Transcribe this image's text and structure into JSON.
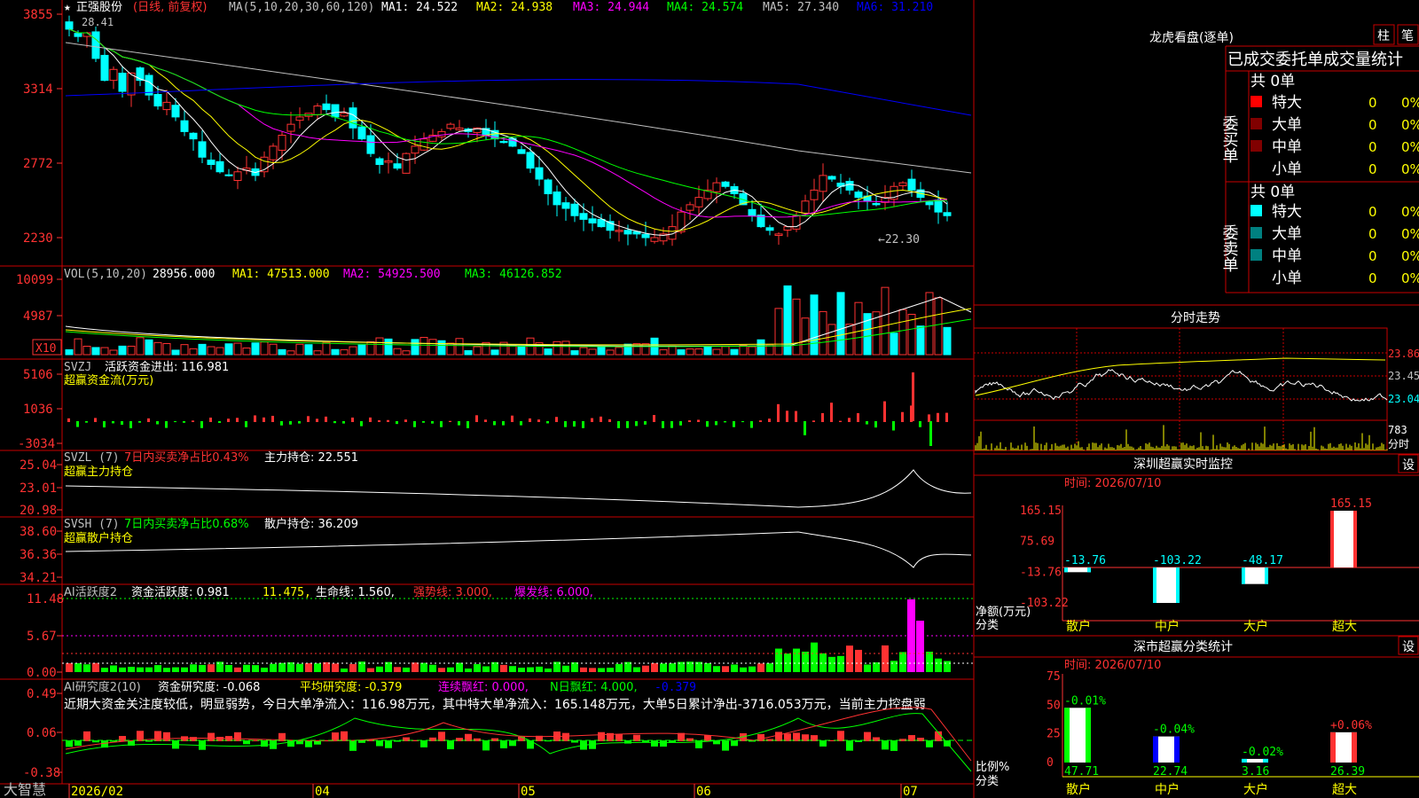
{
  "app": {
    "brand": "大智慧"
  },
  "colors": {
    "bg": "#000000",
    "grid": "#ff0000",
    "up": "#ff3232",
    "down": "#00ffff",
    "white": "#ffffff",
    "yellow": "#ffff00",
    "magenta": "#ff00ff",
    "green": "#00ff00",
    "blue": "#0000ff",
    "axis": "#ff3232"
  },
  "kline": {
    "title_star": "★",
    "stock": "正强股份",
    "period": "(日线, 前复权)",
    "ma_def": "MA(5,10,20,30,60,120)",
    "ma1": "MA1: 24.522",
    "ma2": "MA2: 24.938",
    "ma3": "MA3: 24.944",
    "ma4": "MA4: 24.574",
    "ma5": "MA5: 27.340",
    "ma6": "MA6: 31.210",
    "y_ticks": [
      "3855",
      "3314",
      "2772",
      "2230"
    ],
    "high_note": "28.41",
    "low_note": "←22.30"
  },
  "vol": {
    "def": "VOL(5,10,20)",
    "value": "28956.000",
    "ma1": "MA1: 47513.000",
    "ma2": "MA2: 54925.500",
    "ma3": "MA3: 46126.852",
    "y_ticks": [
      "10099",
      "4987"
    ],
    "unit": "X10"
  },
  "svzj": {
    "def": "SVZJ",
    "label": "活跃资金进出: 116.981",
    "sub": "超赢资金流(万元)",
    "y_ticks": [
      "5106",
      "1036",
      "-3034"
    ]
  },
  "svzl": {
    "def": "SVZL (7)",
    "hint": "7日内买卖净占比0.43%",
    "label": "主力持仓: 22.551",
    "sub": "超赢主力持仓",
    "y_ticks": [
      "25.04",
      "23.01",
      "20.98"
    ]
  },
  "svsh": {
    "def": "SVSH (7)",
    "hint": "7日内买卖净占比0.68%",
    "label": "散户持仓: 36.209",
    "sub": "超赢散户持仓",
    "y_ticks": [
      "38.60",
      "36.36",
      "34.21"
    ]
  },
  "ai2": {
    "def": "AI活跃度2",
    "l1": "资金活跃度: 0.981",
    "l2": "11.475,",
    "l3": "生命线: 1.560,",
    "l4": "强势线: 3.000,",
    "l5": "爆发线: 6.000,",
    "y_ticks": [
      "11.48",
      "5.67",
      "0.00"
    ]
  },
  "air": {
    "def": "AI研究度2(10)",
    "l1": "资金研究度: -0.068",
    "l2": "平均研究度: -0.379",
    "l3": "连续飘红: 0.000,",
    "l4": "N日飘红: 4.000,",
    "l5": "-0.379",
    "y_ticks": [
      "0.49",
      "0.06",
      "-0.38"
    ],
    "text": "近期大资金关注度较低，明显弱势，今日大单净流入：116.98万元，其中特大单净流入：165.148万元，大单5日累计净出-3716.053万元，当前主力控盘弱"
  },
  "xaxis": {
    "labels": [
      "2026/02",
      "04",
      "05",
      "06",
      "07"
    ]
  },
  "panel1": {
    "title": "龙虎看盘(逐单)",
    "btn1": "柱",
    "btn2": "笔",
    "tabs": "已成交委托单成交量统计",
    "buy_label": "委买单",
    "sell_label": "委卖单",
    "buy_total": "共 0单",
    "sell_total": "共 0单",
    "rows": [
      "特大",
      "大单",
      "中单",
      "小单"
    ],
    "zero": "0",
    "pct": "0%"
  },
  "panel2": {
    "title": "分时走势",
    "y_labels": [
      "23.86",
      "23.45",
      "23.04"
    ],
    "vol_label": "783",
    "vol_unit": "分时"
  },
  "panel3": {
    "title": "深圳超赢实时监控",
    "btn": "设",
    "time": "时间: 2026/07/10",
    "y_ticks": [
      "165.15",
      "75.69",
      "-13.76",
      "-103.22"
    ],
    "ylabel1": "净额(万元)",
    "ylabel2": "分类",
    "cats": [
      "散户",
      "中户",
      "大户",
      "超大"
    ],
    "values": [
      "-13.76",
      "-103.22",
      "-48.17",
      "165.15"
    ]
  },
  "panel4": {
    "title": "深市超赢分类统计",
    "btn": "设",
    "time": "时间: 2026/07/10",
    "y_ticks": [
      "75",
      "50",
      "25",
      "0"
    ],
    "ylabel1": "比例%",
    "ylabel2": "分类",
    "cats": [
      "散户",
      "中户",
      "大户",
      "超大"
    ],
    "pct": [
      "47.71",
      "22.74",
      "3.16",
      "26.39"
    ],
    "chg": [
      "-0.01%",
      "-0.04%",
      "-0.02%",
      "+0.06%"
    ]
  },
  "chart_data": [
    {
      "type": "bar",
      "title": "深圳超赢实时监控",
      "categories": [
        "散户",
        "中户",
        "大户",
        "超大"
      ],
      "values": [
        -13.76,
        -103.22,
        -48.17,
        165.15
      ],
      "ylabel": "净额(万元)",
      "ylim": [
        -103.22,
        165.15
      ]
    },
    {
      "type": "bar",
      "title": "深市超赢分类统计",
      "categories": [
        "散户",
        "中户",
        "大户",
        "超大"
      ],
      "values": [
        47.71,
        22.74,
        3.16,
        26.39
      ],
      "ylabel": "比例%",
      "ylim": [
        0,
        75
      ]
    }
  ]
}
